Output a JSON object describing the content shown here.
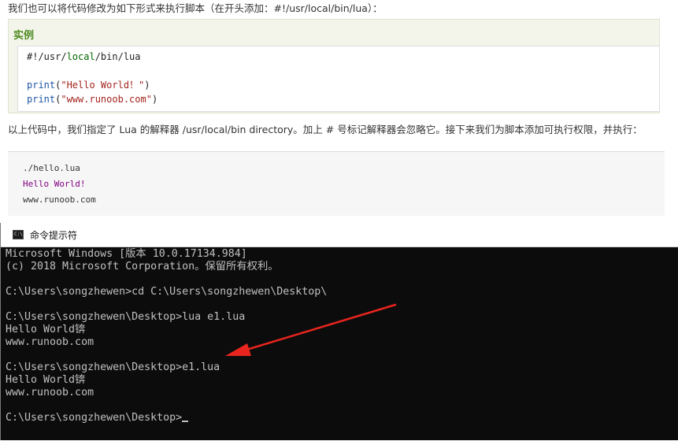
{
  "web": {
    "intro": "我们也可以将代码修改为如下形式来执行脚本（在开头添加：#!/usr/local/bin/lua）：",
    "example": {
      "title": "实例",
      "code": {
        "shebang_prefix": "#!/usr/",
        "shebang_kw": "local",
        "shebang_suffix": "/bin/lua",
        "line1_fn": "print",
        "line1_open": "(",
        "line1_str": "\"Hello World！\"",
        "line1_close": ")",
        "line2_fn": "print",
        "line2_open": "(",
        "line2_str": "\"www.runoob.com\"",
        "line2_close": ")"
      }
    },
    "description": "以上代码中，我们指定了 Lua 的解释器 /usr/local/bin directory。加上 # 号标记解释器会忽略它。接下来我们为脚本添加可执行权限，并执行：",
    "output": {
      "command": "./hello.lua",
      "hello": "Hello World!",
      "site": "www.runoob.com"
    }
  },
  "cmd": {
    "title": "命令提示符",
    "icon": "cmd-window-icon",
    "lines": [
      "Microsoft Windows [版本 10.0.17134.984]",
      "(c) 2018 Microsoft Corporation。保留所有权利。",
      "",
      "C:\\Users\\songzhewen>cd C:\\Users\\songzhewen\\Desktop\\",
      "",
      "C:\\Users\\songzhewen\\Desktop>lua e1.lua",
      "Hello World锛",
      "www.runoob.com",
      "",
      "C:\\Users\\songzhewen\\Desktop>e1.lua",
      "Hello World锛",
      "www.runoob.com",
      "",
      "C:\\Users\\songzhewen\\Desktop>"
    ]
  },
  "colors": {
    "example_title": "#4e8a20",
    "keyword": "#006600",
    "function": "#1f57a7",
    "string": "#a3251e",
    "output_hello": "#800080",
    "cmd_background": "#0c0c0c",
    "cmd_text": "#c0c0c0",
    "annotation_arrow": "#e8251e"
  }
}
